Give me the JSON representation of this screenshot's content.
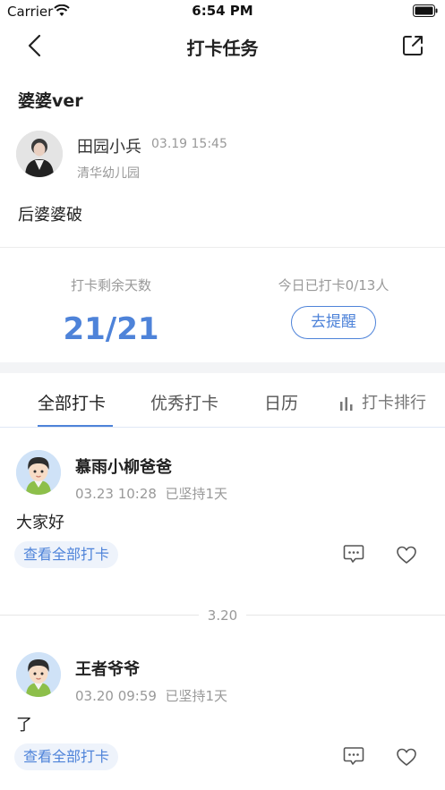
{
  "status_bar": {
    "carrier": "Carrier",
    "time": "6:54 PM"
  },
  "nav": {
    "title": "打卡任务",
    "back_icon": "chevron-left-icon",
    "share_icon": "share-external-icon"
  },
  "task": {
    "title": "婆婆ver",
    "author_name": "田园小兵",
    "author_time": "03.19 15:45",
    "author_school": "清华幼儿园",
    "content": "后婆婆破"
  },
  "stats": {
    "remaining_label": "打卡剩余天数",
    "remaining_value": "21/21",
    "today_label": "今日已打卡0/13人",
    "remind_label": "去提醒"
  },
  "tabs": [
    {
      "label": "全部打卡",
      "active": true
    },
    {
      "label": "优秀打卡",
      "active": false
    },
    {
      "label": "日历",
      "active": false
    },
    {
      "label": "打卡排行",
      "active": false,
      "icon": "bar-chart-icon"
    }
  ],
  "accent_color": "#4e83d9",
  "posts": [
    {
      "name": "慕雨小柳爸爸",
      "time": "03.23 10:28",
      "streak": "已坚持1天",
      "text": "大家好",
      "view_all_label": "查看全部打卡"
    },
    {
      "name": "王者爷爷",
      "time": "03.20 09:59",
      "streak": "已坚持1天",
      "text": "了",
      "view_all_label": "查看全部打卡"
    }
  ],
  "date_separator": "3.20"
}
